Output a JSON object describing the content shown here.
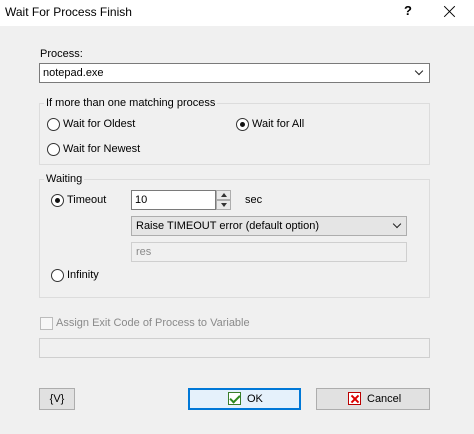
{
  "window": {
    "title": "Wait For Process Finish",
    "help_glyph": "?"
  },
  "process": {
    "label": "Process:",
    "value": "notepad.exe"
  },
  "matching": {
    "group_title": "If more than one matching process",
    "options": [
      {
        "label": "Wait for Oldest",
        "selected": false
      },
      {
        "label": "Wait for All",
        "selected": true
      },
      {
        "label": "Wait for Newest",
        "selected": false
      }
    ]
  },
  "waiting": {
    "group_title": "Waiting",
    "timeout_label": "Timeout",
    "timeout_selected": true,
    "timeout_value": "10",
    "unit": "sec",
    "on_timeout_option": "Raise TIMEOUT error (default option)",
    "result_placeholder": "res",
    "infinity_label": "Infinity",
    "infinity_selected": false
  },
  "exit_code": {
    "label": "Assign Exit Code of Process to Variable",
    "checked": false,
    "variable_value": ""
  },
  "buttons": {
    "variables": "{V}",
    "ok": "OK",
    "cancel": "Cancel"
  },
  "colors": {
    "dialog_bg": "#f0f0f0",
    "default_button_border": "#0078d7",
    "ok_icon": "#2e8b1d",
    "cancel_icon": "#d00000"
  }
}
